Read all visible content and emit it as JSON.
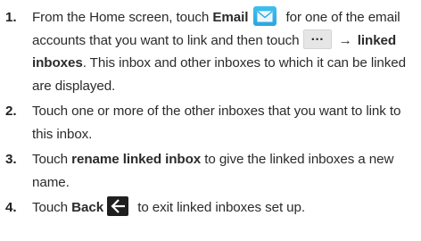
{
  "steps": [
    {
      "number": "1.",
      "t1": "From the Home screen, touch ",
      "b1": "Email",
      "t2": " for one of the email accounts that you want to link and then touch ",
      "more_symbol": "…",
      "arrow": "→",
      "b2": "linked inboxes",
      "t3": ". This inbox and other inboxes to which it can be linked are displayed.",
      "icon_email": "email-envelope-icon",
      "icon_more": "more-options-icon"
    },
    {
      "number": "2.",
      "text": "Touch one or more of the other inboxes that you want to link to this inbox."
    },
    {
      "number": "3.",
      "t1": "Touch ",
      "b1": "rename linked inbox",
      "t2": " to give the linked inboxes a new name."
    },
    {
      "number": "4.",
      "t1": "Touch ",
      "b1": "Back",
      "t2": " to exit linked inboxes set up.",
      "icon_back": "back-arrow-icon"
    }
  ],
  "colors": {
    "email_icon": "#2aa6e0",
    "back_icon_bg": "#1f1f1f",
    "more_icon_bg": "#e6e6e6"
  }
}
